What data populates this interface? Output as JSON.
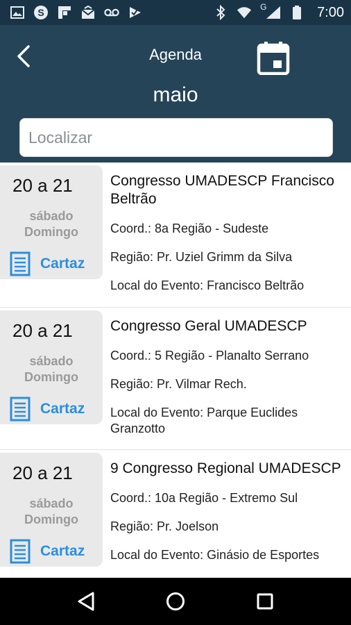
{
  "status_bar": {
    "time": "7:00",
    "network_label": "G"
  },
  "header": {
    "title": "Agenda",
    "month": "maio"
  },
  "search": {
    "placeholder": "Localizar",
    "value": ""
  },
  "events": [
    {
      "date_range": "20 a 21",
      "day1": "sábado",
      "day2": "Domingo",
      "cartaz_label": "Cartaz",
      "title": "Congresso UMADESCP Francisco Beltrão",
      "coord": "Coord.: 8a Região - Sudeste",
      "regiao": "Região: Pr. Uziel Grimm da Silva",
      "local": "Local do Evento: Francisco Beltrão"
    },
    {
      "date_range": "20 a 21",
      "day1": "sábado",
      "day2": "Domingo",
      "cartaz_label": "Cartaz",
      "title": "Congresso Geral UMADESCP",
      "coord": "Coord.: 5 Região - Planalto Serrano",
      "regiao": "Região: Pr. Vilmar Rech.",
      "local": "Local do Evento: Parque Euclides Granzotto"
    },
    {
      "date_range": "20 a 21",
      "day1": "sábado",
      "day2": "Domingo",
      "cartaz_label": "Cartaz",
      "title": "9 Congresso Regional UMADESCP",
      "coord": "Coord.: 10a Região - Extremo Sul",
      "regiao": "Região: Pr. Joelson",
      "local": "Local do Evento: Ginásio de Esportes"
    }
  ],
  "colors": {
    "header_bg": "#254458",
    "status_bg": "#193447",
    "accent": "#2a8ee0",
    "date_box": "#e9e9e9"
  }
}
